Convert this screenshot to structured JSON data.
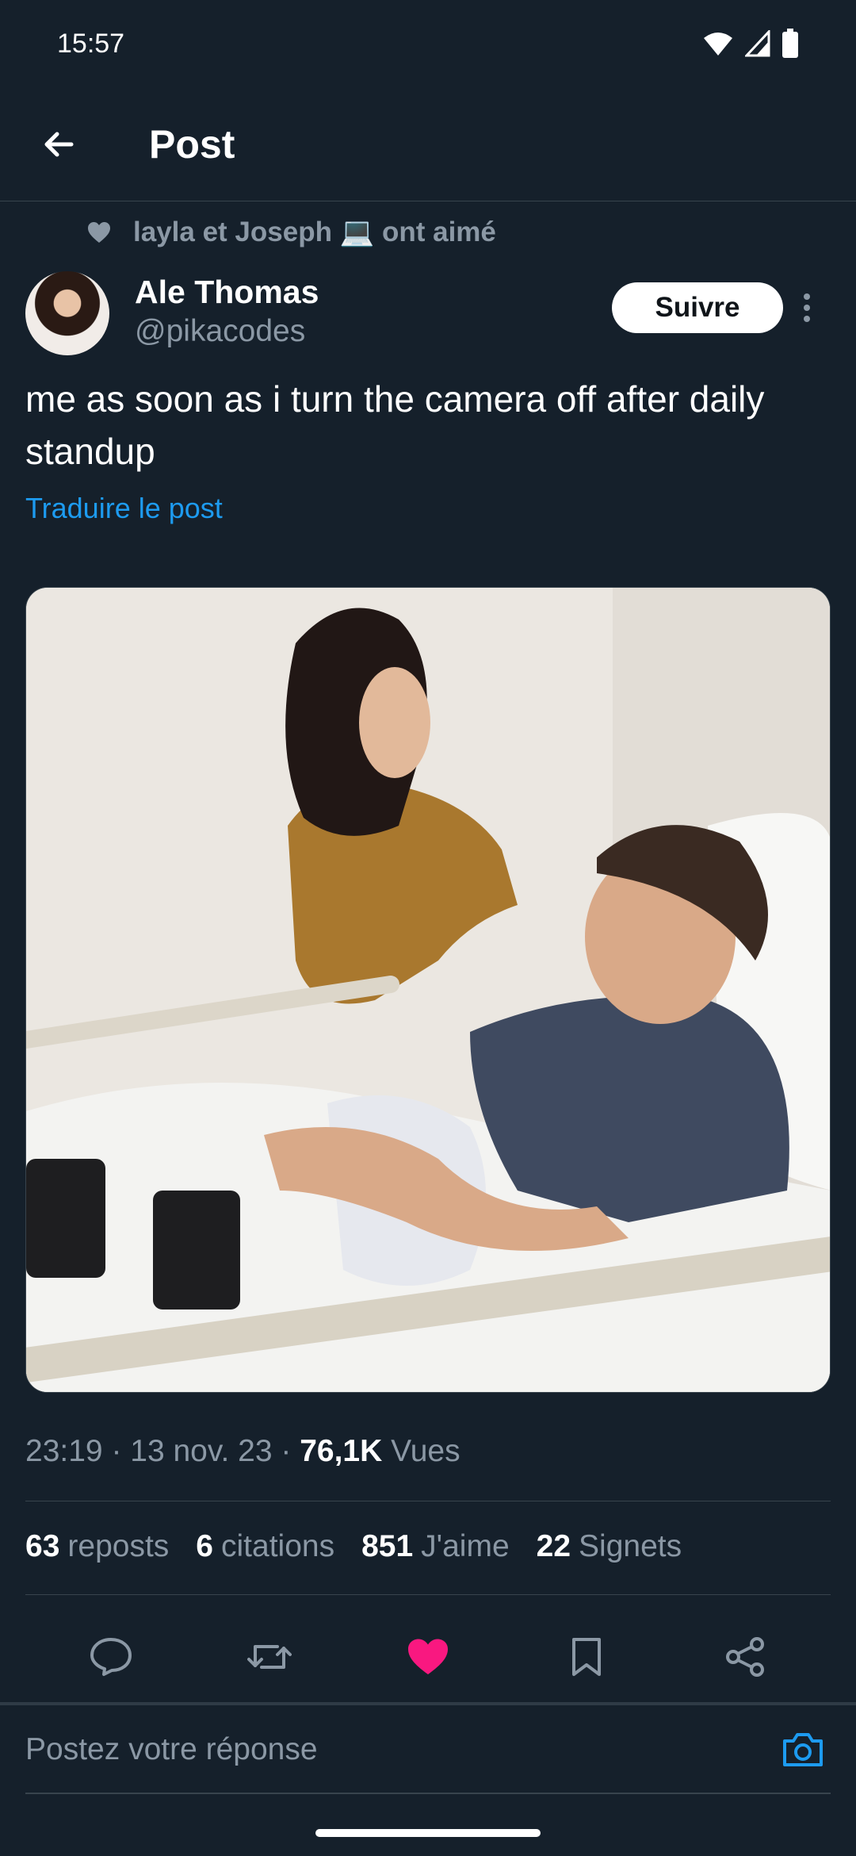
{
  "status_bar": {
    "time": "15:57"
  },
  "header": {
    "title": "Post"
  },
  "social_context": {
    "text": "layla et Joseph 💻 ont aimé"
  },
  "author": {
    "name": "Ale Thomas",
    "handle": "@pikacodes"
  },
  "follow_button": {
    "label": "Suivre"
  },
  "post": {
    "text": "me as soon as i turn the camera off after daily standup",
    "translate_label": "Traduire le post"
  },
  "meta": {
    "time": "23:19",
    "date": "13 nov. 23",
    "views": "76,1K",
    "views_label": "Vues",
    "sep": " · "
  },
  "stats": [
    {
      "num": "63",
      "label": "reposts"
    },
    {
      "num": "6",
      "label": "citations"
    },
    {
      "num": "851",
      "label": "J'aime"
    },
    {
      "num": "22",
      "label": "Signets"
    }
  ],
  "reply": {
    "placeholder": "Postez votre réponse"
  },
  "colors": {
    "accent": "#1d9bf0",
    "like": "#f91880",
    "background": "#15202b"
  },
  "icons": [
    "arrow-left-icon",
    "heart-icon",
    "more-vertical-icon",
    "reply-icon",
    "repost-icon",
    "like-icon",
    "bookmark-icon",
    "share-icon",
    "camera-icon"
  ]
}
